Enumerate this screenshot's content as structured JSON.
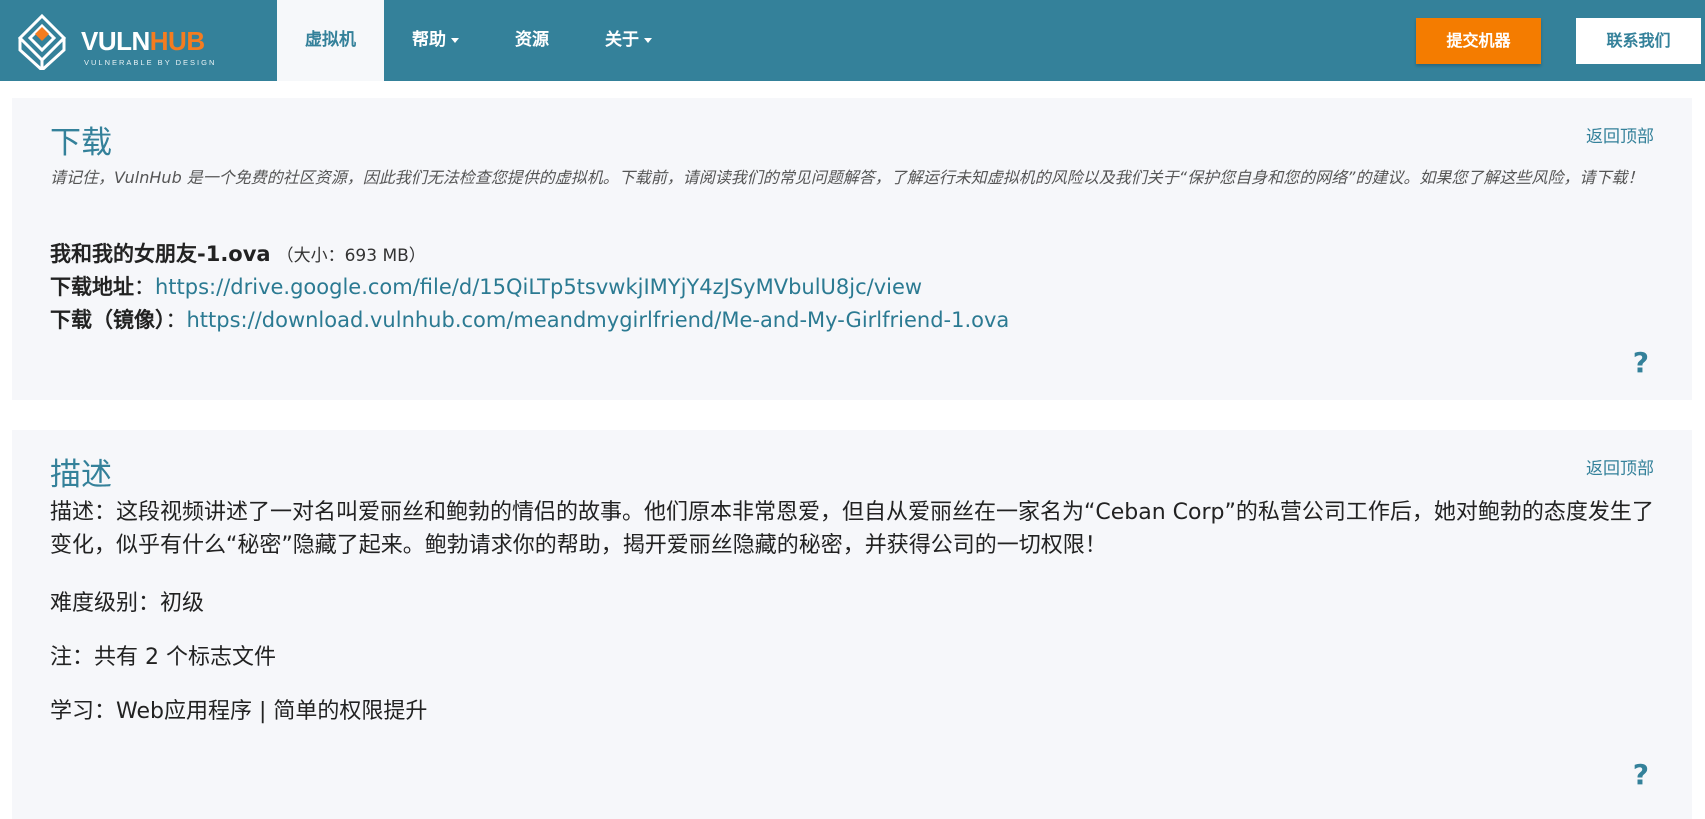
{
  "nav": {
    "logo_text_1": "VULN",
    "logo_text_2": "HUB",
    "logo_tagline": "VULNERABLE BY DESIGN",
    "items": [
      {
        "label": "虚拟机"
      },
      {
        "label": "帮助"
      },
      {
        "label": "资源"
      },
      {
        "label": "关于"
      }
    ],
    "submit_label": "提交机器",
    "contact_label": "联系我们"
  },
  "download": {
    "title": "下载",
    "back_top": "返回顶部",
    "notice": "请记住，VulnHub 是一个免费的社区资源，因此我们无法检查您提供的虚拟机。下载前，请阅读我们的常见问题解答，了解运行未知虚拟机的风险以及我们关于“保护您自身和您的网络”的建议。如果您了解这些风险，请下载！",
    "file_name": "我和我的女朋友-1.ova",
    "file_size": "（大小：693 MB）",
    "link_label": "下载地址",
    "link_url": "https://drive.google.com/file/d/15QiLTp5tsvwkjIMYjY4zJSyMVbulU8jc/view",
    "mirror_label": "下载（镜像）",
    "mirror_url": "https://download.vulnhub.com/meandmygirlfriend/Me-and-My-Girlfriend-1.ova",
    "help": "?"
  },
  "description": {
    "title": "描述",
    "back_top": "返回顶部",
    "text": "描述：这段视频讲述了一对名叫爱丽丝和鲍勃的情侣的故事。他们原本非常恩爱，但自从爱丽丝在一家名为“Ceban Corp”的私营公司工作后，她对鲍勃的态度发生了变化，似乎有什么“秘密”隐藏了起来。鲍勃请求你的帮助，揭开爱丽丝隐藏的秘密，并获得公司的一切权限！",
    "difficulty": "难度级别：初级",
    "note": "注：共有 2 个标志文件",
    "learning": "学习：Web应用程序 | 简单的权限提升",
    "help": "?"
  },
  "colors": {
    "brand": "#34819a",
    "accent": "#f47c00",
    "panel_bg": "#f6f7fa"
  }
}
